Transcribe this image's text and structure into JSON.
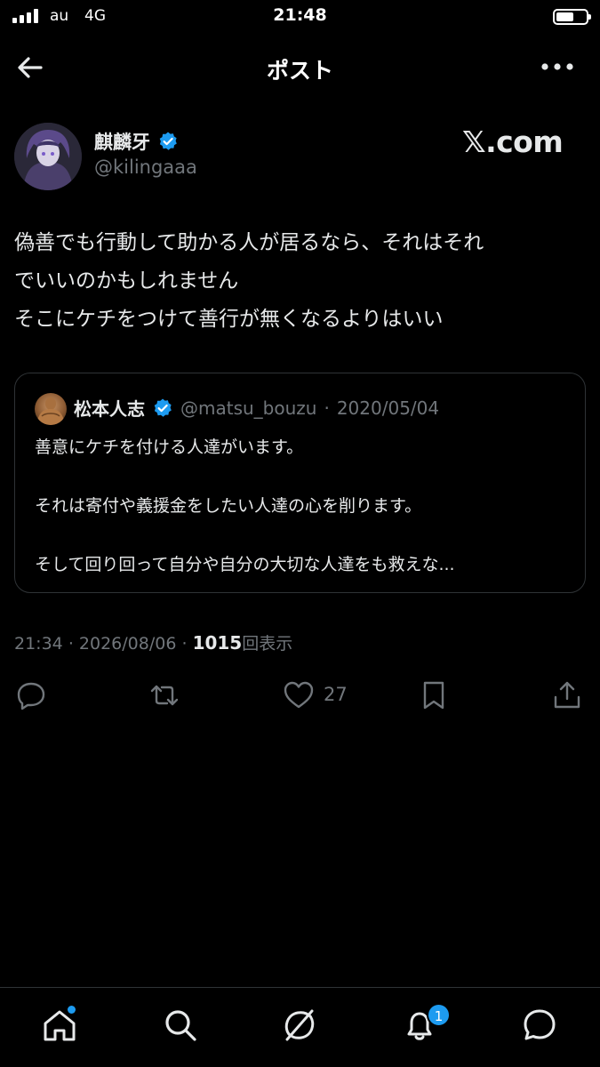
{
  "status_bar": {
    "carrier": "au",
    "network": "4G",
    "time": "21:48",
    "signal_bars": 4,
    "battery_level": 0.6
  },
  "header": {
    "title": "ポスト",
    "back_icon": "arrow-left-icon",
    "more_icon": "more-horizontal-icon"
  },
  "author": {
    "name": "麒麟牙",
    "handle": "@kilingaaa",
    "verified": true,
    "watermark": "𝕏.com"
  },
  "post": {
    "lines": [
      "偽善でも行動して助かる人が居るなら、それはそれ",
      "でいいのかもしれません",
      "そこにケチをつけて善行が無くなるよりはいい"
    ]
  },
  "quote": {
    "name": "松本人志",
    "handle": "@matsu_bouzu",
    "separator": "·",
    "date": "2020/05/04",
    "verified": true,
    "lines": [
      "善意にケチを付ける人達がいます。",
      "それは寄付や義援金をしたい人達の心を削ります。",
      "そして回り回って自分や自分の大切な人達をも救えな..."
    ]
  },
  "meta": {
    "time": "21:34",
    "separator": "·",
    "date": "2026/08/06",
    "views": "1015",
    "views_label": "回表示"
  },
  "actions": {
    "like_count": "27",
    "icons": [
      "reply-icon",
      "retweet-icon",
      "like-icon",
      "bookmark-icon",
      "share-icon"
    ]
  },
  "tabbar": {
    "icons": [
      "home-icon",
      "search-icon",
      "grok-icon",
      "notifications-icon",
      "messages-icon"
    ],
    "notification_count": "1"
  },
  "colors": {
    "background": "#000000",
    "text": "#e7e9ea",
    "muted": "#71767b",
    "accent": "#1d9bf0",
    "border": "#2f3336"
  }
}
